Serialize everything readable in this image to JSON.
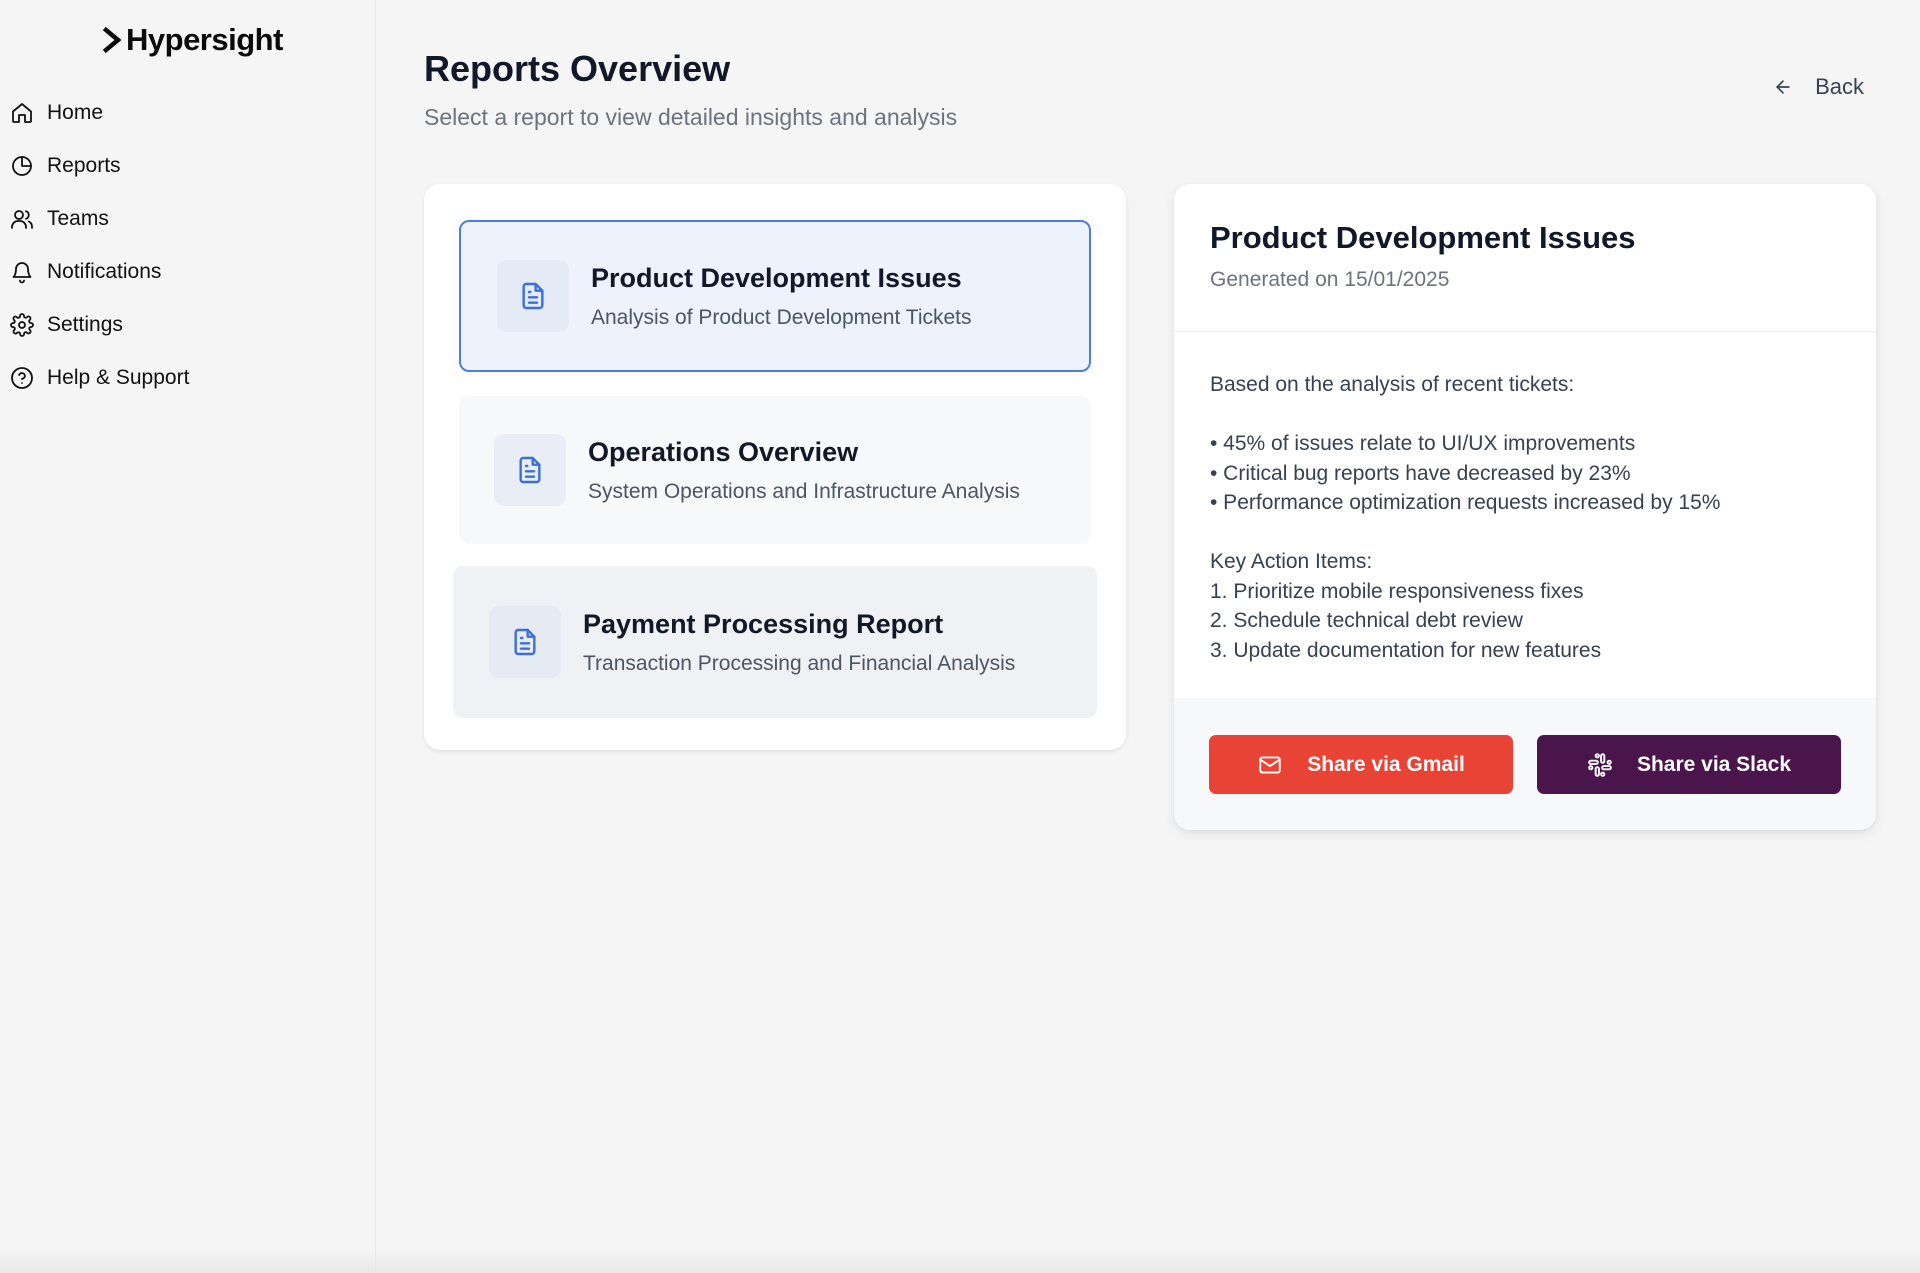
{
  "app": {
    "logo": "Hypersight"
  },
  "sidebar": {
    "items": [
      {
        "label": "Home",
        "icon": "home-icon"
      },
      {
        "label": "Reports",
        "icon": "pie-chart-icon"
      },
      {
        "label": "Teams",
        "icon": "users-icon"
      },
      {
        "label": "Notifications",
        "icon": "bell-icon"
      },
      {
        "label": "Settings",
        "icon": "gear-icon"
      },
      {
        "label": "Help & Support",
        "icon": "help-circle-icon"
      }
    ]
  },
  "header": {
    "title": "Reports Overview",
    "subtitle": "Select a report to view detailed insights and analysis",
    "back_label": "Back"
  },
  "reports": [
    {
      "title": "Product Development Issues",
      "description": "Analysis of Product Development Tickets",
      "selected": true
    },
    {
      "title": "Operations Overview",
      "description": "System Operations and Infrastructure Analysis",
      "selected": false
    },
    {
      "title": "Payment Processing Report",
      "description": "Transaction Processing and Financial Analysis",
      "selected": false
    }
  ],
  "detail": {
    "title": "Product Development Issues",
    "generated": "Generated on 15/01/2025",
    "intro": "Based on the analysis of recent tickets:",
    "bullets": [
      "• 45% of issues relate to UI/UX improvements",
      "• Critical bug reports have decreased by 23%",
      "• Performance optimization requests increased by 15%"
    ],
    "actions_heading": "Key Action Items:",
    "actions": [
      "1. Prioritize mobile responsiveness fixes",
      "2. Schedule technical debt review",
      "3. Update documentation for new features"
    ],
    "share_gmail": "Share via Gmail",
    "share_slack": "Share via Slack"
  },
  "colors": {
    "accent": "#4a7ee0",
    "gmail": "#e94335",
    "slack": "#4a154b"
  }
}
